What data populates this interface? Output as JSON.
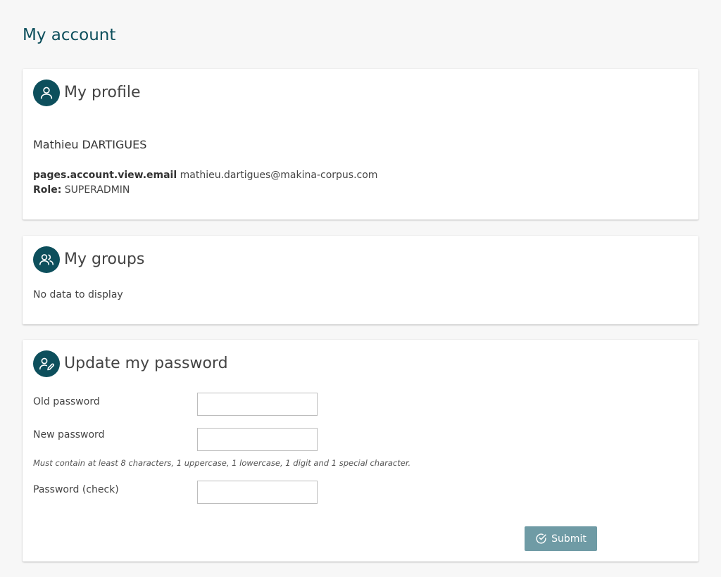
{
  "page": {
    "title": "My account"
  },
  "profile": {
    "title": "My profile",
    "icon": "user-icon",
    "name": "Mathieu DARTIGUES",
    "email_label": "pages.account.view.email",
    "email_value": "mathieu.dartigues@makina-corpus.com",
    "role_label": "Role:",
    "role_value": "SUPERADMIN"
  },
  "groups": {
    "title": "My groups",
    "icon": "users-icon",
    "empty_text": "No data to display"
  },
  "password": {
    "title": "Update my password",
    "icon": "user-edit-icon",
    "old_label": "Old password",
    "old_value": "",
    "new_label": "New password",
    "new_value": "",
    "hint": "Must contain at least 8 characters, 1 uppercase, 1 lowercase, 1 digit and 1 special character.",
    "check_label": "Password (check)",
    "check_value": "",
    "submit_label": "Submit",
    "submit_icon": "check-circle-icon"
  },
  "colors": {
    "background": "#f7f7f7",
    "primary": "#0d4f5c",
    "button": "#6f9ba5",
    "card": "#ffffff"
  }
}
